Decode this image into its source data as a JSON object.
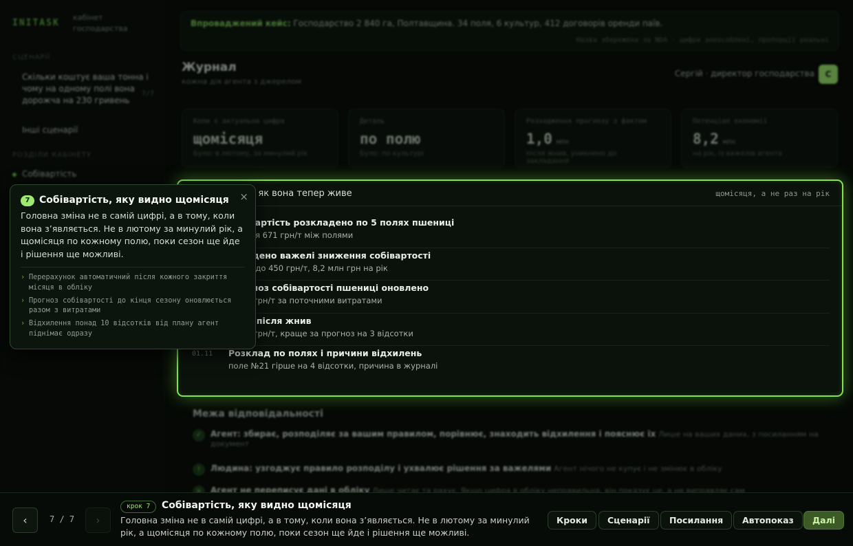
{
  "sidebar": {
    "brand": "INITASK",
    "brand_sub": "кабінет господарства",
    "group1": "СЦЕНАРІЇ",
    "scenario": "Скільки коштує ваша тонна і чому на одному полі вона дорожча на 230 гривень",
    "scenario_count": "7/7",
    "other_scenarios": "Інші сценарії",
    "group2": "РОЗДІЛИ КАБІНЕТУ",
    "section": "Собівартість"
  },
  "banner": {
    "label": "Впроваджений кейс:",
    "text": "Господарство 2 840 га, Полтавщина. 34 поля, 6 культур, 412 договорів оренди паїв.",
    "meta": "Назва збережена за NDA · цифри знеособлені, пропорції реальні"
  },
  "header": {
    "title": "Журнал",
    "subtitle": "кожна дія агента з джерелом",
    "user_name": "Сергій · директор господарства",
    "avatar_letter": "С"
  },
  "kpis": [
    {
      "label": "Коли є актуальна цифра",
      "value": "щомісяця",
      "unit": "",
      "note": "Було: в лютому, за минулий рік"
    },
    {
      "label": "Деталь",
      "value": "по полю",
      "unit": "",
      "note": "Було: по культурі"
    },
    {
      "label": "Розходження прогнозу з фактом",
      "value": "1,0",
      "unit": "млн",
      "note": "після жнив, уникнено до закладання"
    },
    {
      "label": "Потенціал економії",
      "value": "8,2",
      "unit": "млн",
      "note": "на рік, із важелів агента"
    }
  ],
  "journal": {
    "title": "Собівартість, як вона тепер живе",
    "tag": "щомісяця, а не раз на рік",
    "entries": [
      {
        "date": "",
        "title": "Собівартість розкладено по 5 полях пшениці",
        "desc": "Різниця 671 грн/т між полями"
      },
      {
        "date": "",
        "title": "Знайдено важелі зниження собівартості",
        "desc": "Разом до 450 грн/т, 8,2 млн грн на рік"
      },
      {
        "date": "",
        "title": "Прогноз собівартості пшениці оновлено",
        "desc": "5 250 грн/т за поточними витратами"
      },
      {
        "date": "",
        "title": "Факт після жнив",
        "desc": "5 092 грн/т, краще за прогноз на 3 відсотки"
      },
      {
        "date": "01.11",
        "title": "Розклад по полях і причини відхилень",
        "desc": "поле №21 гірше на 4 відсотки, причина в журналі"
      }
    ]
  },
  "responsibility": {
    "title": "Межа відповідальності",
    "rows": [
      {
        "icon": "✓",
        "bold": "Агент: збирає, розподіляє за вашим правилом, порівнює, знаходить відхилення і пояснює їх",
        "rest": "Лише на ваших даних, з посиланням на документ"
      },
      {
        "icon": "!",
        "bold": "Людина: узгоджує правило розподілу і ухвалює рішення за важелями",
        "rest": "Агент нічого не купує і не змінює в обліку"
      },
      {
        "icon": "×",
        "bold": "Агент не переписує дані в обліку",
        "rest": "Лише читає та рахує. Якщо цифра в обліку неправильна, він показує це, а не виправляє сам"
      }
    ]
  },
  "tooltip": {
    "step": "7",
    "title": "Собівартість, яку видно щомісяця",
    "body": "Головна зміна не в самій цифрі, а в тому, коли вона з’являється. Не в лютому за минулий рік, а щомісяця по кожному полю, поки сезон ще йде і рішення ще можливі.",
    "close": "×",
    "bullets": [
      "Перерахунок автоматичний після кожного закриття місяця в обліку",
      "Прогноз собівартості до кінця сезону оновлюється разом з витратами",
      "Відхилення понад 10 відсотків від плану агент піднімає одразу"
    ]
  },
  "bottom": {
    "prev": "‹",
    "next": "›",
    "pager": "7 / 7",
    "step_badge": "крок 7",
    "step_title": "Собівартість, яку видно щомісяця",
    "step_desc": "Головна зміна не в самій цифрі, а в тому, коли вона з’являється. Не в лютому за минулий рік, а щомісяця по кожному полю, поки сезон ще йде і рішення ще можливі.",
    "buttons": [
      "Кроки",
      "Сценарії",
      "Посилання",
      "Автопоказ",
      "Далі"
    ]
  },
  "colors": {
    "accent": "#86e24d",
    "background": "#050805",
    "primary_button": "#3c5a26"
  }
}
